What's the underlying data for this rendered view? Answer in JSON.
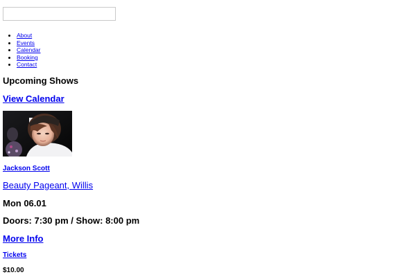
{
  "search": {
    "value": "",
    "placeholder": ""
  },
  "nav": {
    "items": [
      {
        "label": "About"
      },
      {
        "label": "Events"
      },
      {
        "label": "Calendar"
      },
      {
        "label": "Booking"
      },
      {
        "label": "Contact"
      }
    ]
  },
  "shows": {
    "heading": "Upcoming Shows",
    "view_calendar": "View Calendar",
    "event": {
      "artist": "Jackson Scott",
      "venue": "Beauty Pageant, Willis",
      "date": "Mon 06.01",
      "times": "Doors: 7:30 pm / Show: 8:00 pm",
      "more_info": "More Info",
      "tickets": "Tickets",
      "price": "$10.00"
    }
  },
  "colors": {
    "link": "#0000ee",
    "text": "#000000",
    "background": "#ffffff"
  }
}
